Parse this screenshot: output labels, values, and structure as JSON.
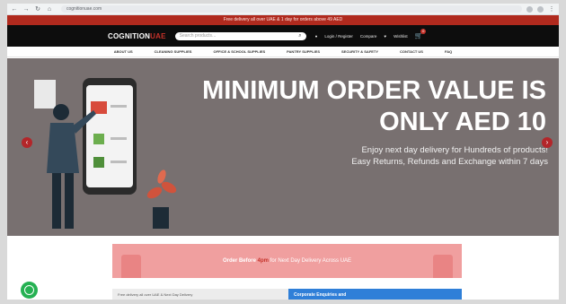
{
  "browser": {
    "url": "cognitionuae.com"
  },
  "banner": {
    "text": "Free delivery all over UAE & 1 day for orders above 49 AED"
  },
  "header": {
    "logo_main": "COGNITION",
    "logo_accent": "UAE",
    "search_placeholder": "Search products...",
    "login_label": "Login / Register",
    "wishlist_label": "Wishlist",
    "compare_label": "Compare",
    "cart_count": "0"
  },
  "menu": {
    "items": [
      "ABOUT US",
      "CLEANING SUPPLIES",
      "OFFICE & SCHOOL SUPPLIES",
      "PANTRY SUPPLIES",
      "SECURITY & SAFETY",
      "CONTACT US",
      "FAQ"
    ]
  },
  "hero": {
    "line1": "MINIMUM ORDER VALUE IS",
    "line2": "ONLY AED 10",
    "sub1": "Enjoy next day delivery for Hundreds of products!",
    "sub2": "Easy Returns, Refunds and Exchange within 7 days"
  },
  "promo": {
    "lead": "Order Before",
    "time": "4pm",
    "rest": "for Next Day Delivery Across UAE"
  },
  "cards": {
    "left": "Free delivery all over UAE & Next Day Delivery",
    "right": "Corporate Enquiries and"
  },
  "colors": {
    "banner": "#b02a1e",
    "header": "#0d0d0d",
    "hero_bg": "#787070",
    "accent": "#c6322a",
    "promo": "#f09f9f"
  }
}
